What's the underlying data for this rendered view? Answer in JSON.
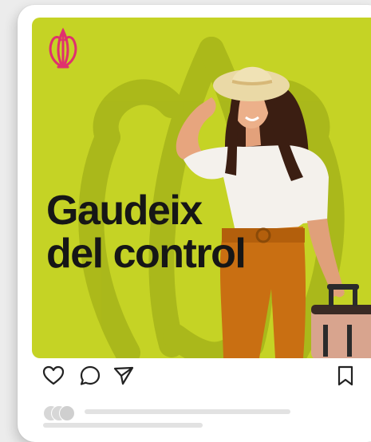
{
  "post": {
    "headline_line1": "Gaudeix",
    "headline_line2": "del control",
    "background_color": "#c5d325",
    "accent_color": "#e0306e"
  },
  "actions": {
    "like_icon": "heart-icon",
    "comment_icon": "comment-icon",
    "share_icon": "paper-plane-icon",
    "save_icon": "bookmark-icon"
  }
}
